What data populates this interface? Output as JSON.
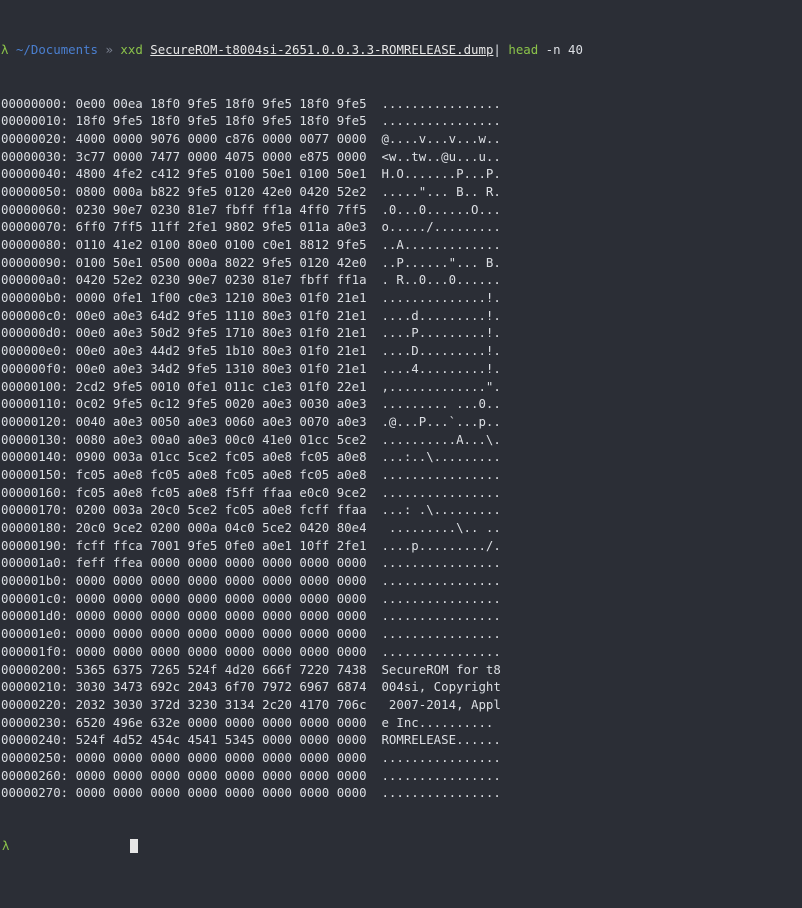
{
  "prompt": {
    "symbol": "λ",
    "cwd": "~/Documents",
    "separator": "»",
    "command": "xxd",
    "file": "SecureROM-t8004si-2651.0.0.3.3-ROMRELEASE.dump",
    "pipe": "|",
    "pipe_cmd": "head",
    "pipe_args": "-n 40"
  },
  "rows": [
    {
      "offset": "00000000:",
      "hex": "0e00 00ea 18f0 9fe5 18f0 9fe5 18f0 9fe5",
      "ascii": "................"
    },
    {
      "offset": "00000010:",
      "hex": "18f0 9fe5 18f0 9fe5 18f0 9fe5 18f0 9fe5",
      "ascii": "................"
    },
    {
      "offset": "00000020:",
      "hex": "4000 0000 9076 0000 c876 0000 0077 0000",
      "ascii": "@....v...v...w.."
    },
    {
      "offset": "00000030:",
      "hex": "3c77 0000 7477 0000 4075 0000 e875 0000",
      "ascii": "<w..tw..@u...u.."
    },
    {
      "offset": "00000040:",
      "hex": "4800 4fe2 c412 9fe5 0100 50e1 0100 50e1",
      "ascii": "H.O.......P...P."
    },
    {
      "offset": "00000050:",
      "hex": "0800 000a b822 9fe5 0120 42e0 0420 52e2",
      "ascii": ".....\"... B.. R."
    },
    {
      "offset": "00000060:",
      "hex": "0230 90e7 0230 81e7 fbff ff1a 4ff0 7ff5",
      "ascii": ".0...0......O..."
    },
    {
      "offset": "00000070:",
      "hex": "6ff0 7ff5 11ff 2fe1 9802 9fe5 011a a0e3",
      "ascii": "o...../........."
    },
    {
      "offset": "00000080:",
      "hex": "0110 41e2 0100 80e0 0100 c0e1 8812 9fe5",
      "ascii": "..A............."
    },
    {
      "offset": "00000090:",
      "hex": "0100 50e1 0500 000a 8022 9fe5 0120 42e0",
      "ascii": "..P......\"... B."
    },
    {
      "offset": "000000a0:",
      "hex": "0420 52e2 0230 90e7 0230 81e7 fbff ff1a",
      "ascii": ". R..0...0......"
    },
    {
      "offset": "000000b0:",
      "hex": "0000 0fe1 1f00 c0e3 1210 80e3 01f0 21e1",
      "ascii": "..............!."
    },
    {
      "offset": "000000c0:",
      "hex": "00e0 a0e3 64d2 9fe5 1110 80e3 01f0 21e1",
      "ascii": "....d.........!."
    },
    {
      "offset": "000000d0:",
      "hex": "00e0 a0e3 50d2 9fe5 1710 80e3 01f0 21e1",
      "ascii": "....P.........!."
    },
    {
      "offset": "000000e0:",
      "hex": "00e0 a0e3 44d2 9fe5 1b10 80e3 01f0 21e1",
      "ascii": "....D.........!."
    },
    {
      "offset": "000000f0:",
      "hex": "00e0 a0e3 34d2 9fe5 1310 80e3 01f0 21e1",
      "ascii": "....4.........!."
    },
    {
      "offset": "00000100:",
      "hex": "2cd2 9fe5 0010 0fe1 011c c1e3 01f0 22e1",
      "ascii": ",.............\"."
    },
    {
      "offset": "00000110:",
      "hex": "0c02 9fe5 0c12 9fe5 0020 a0e3 0030 a0e3",
      "ascii": "......... ...0.."
    },
    {
      "offset": "00000120:",
      "hex": "0040 a0e3 0050 a0e3 0060 a0e3 0070 a0e3",
      "ascii": ".@...P...`...p.."
    },
    {
      "offset": "00000130:",
      "hex": "0080 a0e3 00a0 a0e3 00c0 41e0 01cc 5ce2",
      "ascii": "..........A...\\."
    },
    {
      "offset": "00000140:",
      "hex": "0900 003a 01cc 5ce2 fc05 a0e8 fc05 a0e8",
      "ascii": "...:..\\........."
    },
    {
      "offset": "00000150:",
      "hex": "fc05 a0e8 fc05 a0e8 fc05 a0e8 fc05 a0e8",
      "ascii": "................"
    },
    {
      "offset": "00000160:",
      "hex": "fc05 a0e8 fc05 a0e8 f5ff ffaa e0c0 9ce2",
      "ascii": "................"
    },
    {
      "offset": "00000170:",
      "hex": "0200 003a 20c0 5ce2 fc05 a0e8 fcff ffaa",
      "ascii": "...: .\\........."
    },
    {
      "offset": "00000180:",
      "hex": "20c0 9ce2 0200 000a 04c0 5ce2 0420 80e4",
      "ascii": " .........\\.. .."
    },
    {
      "offset": "00000190:",
      "hex": "fcff ffca 7001 9fe5 0fe0 a0e1 10ff 2fe1",
      "ascii": "....p........./."
    },
    {
      "offset": "000001a0:",
      "hex": "feff ffea 0000 0000 0000 0000 0000 0000",
      "ascii": "................"
    },
    {
      "offset": "000001b0:",
      "hex": "0000 0000 0000 0000 0000 0000 0000 0000",
      "ascii": "................"
    },
    {
      "offset": "000001c0:",
      "hex": "0000 0000 0000 0000 0000 0000 0000 0000",
      "ascii": "................"
    },
    {
      "offset": "000001d0:",
      "hex": "0000 0000 0000 0000 0000 0000 0000 0000",
      "ascii": "................"
    },
    {
      "offset": "000001e0:",
      "hex": "0000 0000 0000 0000 0000 0000 0000 0000",
      "ascii": "................"
    },
    {
      "offset": "000001f0:",
      "hex": "0000 0000 0000 0000 0000 0000 0000 0000",
      "ascii": "................"
    },
    {
      "offset": "00000200:",
      "hex": "5365 6375 7265 524f 4d20 666f 7220 7438",
      "ascii": "SecureROM for t8"
    },
    {
      "offset": "00000210:",
      "hex": "3030 3473 692c 2043 6f70 7972 6967 6874",
      "ascii": "004si, Copyright"
    },
    {
      "offset": "00000220:",
      "hex": "2032 3030 372d 3230 3134 2c20 4170 706c",
      "ascii": " 2007-2014, Appl"
    },
    {
      "offset": "00000230:",
      "hex": "6520 496e 632e 0000 0000 0000 0000 0000",
      "ascii": "e Inc.........."
    },
    {
      "offset": "00000240:",
      "hex": "524f 4d52 454c 4541 5345 0000 0000 0000",
      "ascii": "ROMRELEASE......"
    },
    {
      "offset": "00000250:",
      "hex": "0000 0000 0000 0000 0000 0000 0000 0000",
      "ascii": "................"
    },
    {
      "offset": "00000260:",
      "hex": "0000 0000 0000 0000 0000 0000 0000 0000",
      "ascii": "................"
    },
    {
      "offset": "00000270:",
      "hex": "0000 0000 0000 0000 0000 0000 0000 0000",
      "ascii": "................"
    }
  ]
}
